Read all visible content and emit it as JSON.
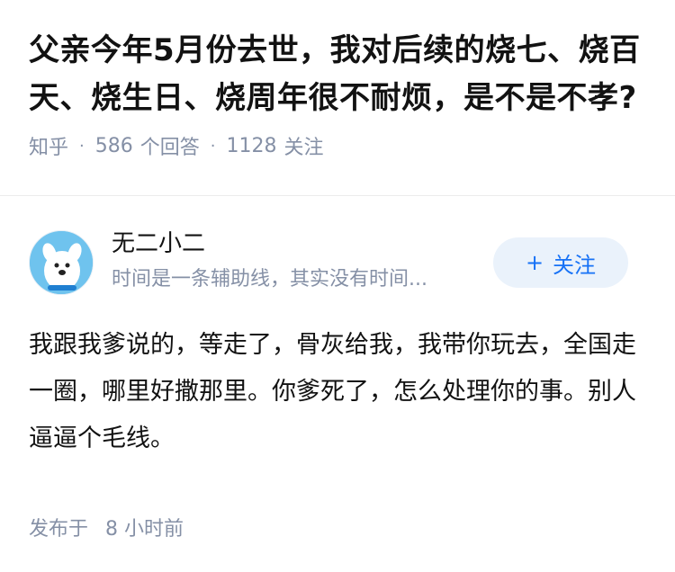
{
  "question": {
    "title": "父亲今年5月份去世，我对后续的烧七、烧百天、烧生日、烧周年很不耐烦，是不是不孝?",
    "source": "知乎",
    "answer_count": "586",
    "answer_label": "个回答",
    "follow_count": "1128",
    "follow_label": "关注"
  },
  "answer": {
    "author": {
      "name": "无二小二",
      "bio": "时间是一条辅助线，其实没有时间...",
      "avatar_icon": "cartoon-dog-avatar"
    },
    "follow_button": {
      "icon": "+",
      "label": "关注"
    },
    "content": "我跟我爹说的，等走了，骨灰给我，我带你玩去，全国走一圈，哪里好撒那里。你爹死了，怎么处理你的事。别人逼逼个毛线。",
    "published_label": "发布于",
    "published_time": "8 小时前"
  },
  "colors": {
    "title": "#121212",
    "meta": "#8590a6",
    "accent": "#1772f6",
    "follow_bg": "#eaf2fb",
    "avatar_bg": "#6fc3ee"
  }
}
